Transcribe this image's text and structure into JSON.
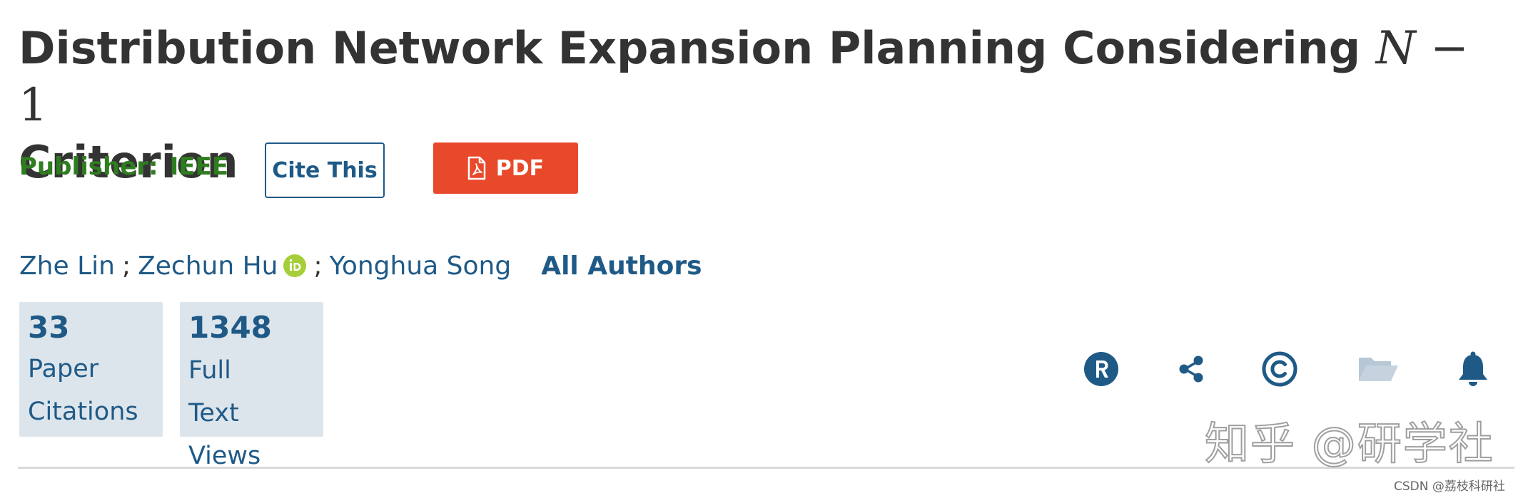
{
  "title": {
    "text_before": "Distribution Network Expansion Planning Considering ",
    "math_var": "N",
    "math_rest": " − 1",
    "text_after": "Criterion"
  },
  "publisher": {
    "label": "Publisher:",
    "name": "IEEE"
  },
  "buttons": {
    "cite": "Cite This",
    "pdf": "PDF"
  },
  "authors": {
    "list": [
      "Zhe Lin",
      "Zechun Hu",
      "Yonghua Song"
    ],
    "separator": ";",
    "all_authors": "All Authors"
  },
  "metrics": {
    "citations": {
      "count": "33",
      "label_line1": "Paper",
      "label_line2": "Citations"
    },
    "views": {
      "count": "1348",
      "label_line1": "Full",
      "label_line2": "Text",
      "label_line3": "Views"
    }
  },
  "icons": {
    "rights": "rights-icon",
    "share": "share-icon",
    "copyright": "copyright-icon",
    "folder": "folder-icon",
    "alert": "bell-icon"
  },
  "colors": {
    "link_blue": "#1f5a87",
    "publisher_green": "#2e7d1f",
    "pdf_red": "#e8492a",
    "metric_bg": "#dde5ec",
    "orcid_green": "#a6ce39",
    "folder_gray": "#b7c7d6"
  },
  "watermark": {
    "text": "知乎 @研学社",
    "credit": "CSDN @荔枝科研社"
  }
}
